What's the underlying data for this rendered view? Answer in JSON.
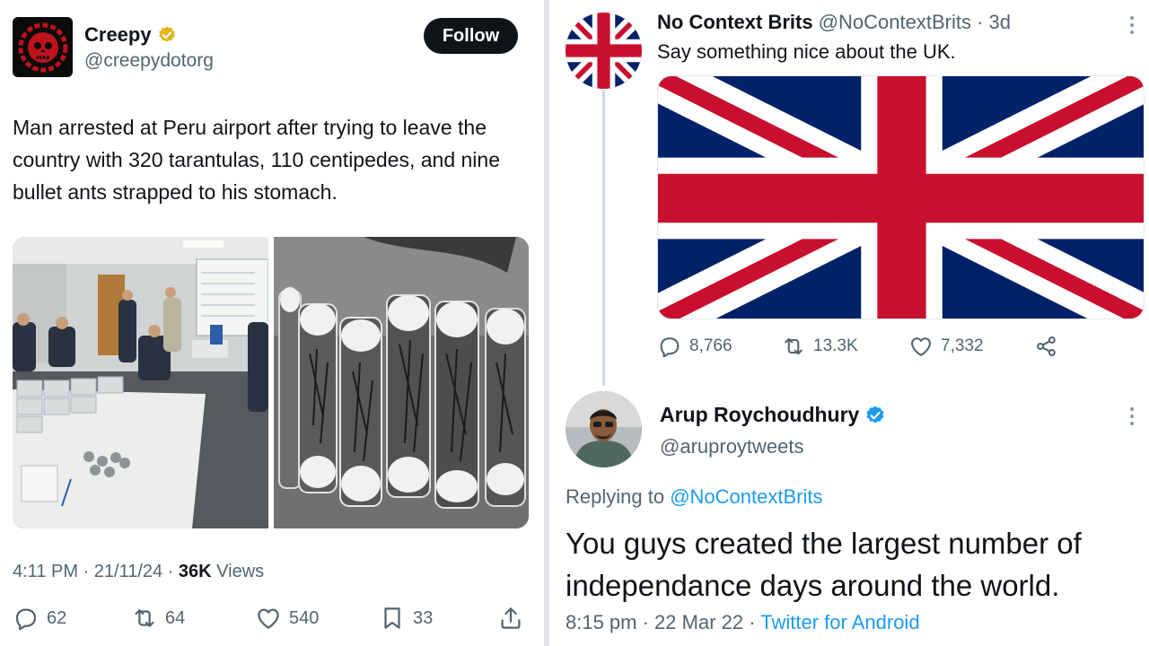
{
  "left_tweet": {
    "author_name": "Creepy",
    "author_handle": "@creepydotorg",
    "follow_label": "Follow",
    "text": "Man arrested at Peru airport after trying to leave the country with 320 tarantulas, 110 centipedes, and nine bullet ants strapped to his stomach.",
    "time": "4:11 PM · 21/11/24 · ",
    "views_count": "36K",
    "views_label": " Views",
    "actions": {
      "replies": "62",
      "retweets": "64",
      "likes": "540",
      "bookmarks": "33"
    },
    "icons": [
      "skull-logo-icon",
      "verified-gold-icon",
      "reply-icon",
      "retweet-icon",
      "like-icon",
      "bookmark-icon",
      "share-icon"
    ],
    "accent_color": "#c0121c"
  },
  "right_thread": {
    "tweet1": {
      "author_name": "No Context Brits",
      "author_handle": "@NoContextBrits",
      "age": " · 3d",
      "text": "Say something nice about the UK.",
      "actions": {
        "replies": "8,766",
        "retweets": "13.3K",
        "likes": "7,332"
      }
    },
    "tweet2": {
      "author_name": "Arup Roychoudhury",
      "author_handle": "@aruproytweets",
      "replying_prefix": "Replying to ",
      "replying_handle": "@NoContextBrits",
      "text": "You guys created the largest number of independance days around the world.",
      "time": "8:15 pm · 22 Mar 22 · ",
      "source": "Twitter for Android"
    },
    "link_color": "#1d9bf0",
    "flag_colors": {
      "blue": "#012169",
      "red": "#c8102e",
      "white": "#ffffff"
    }
  }
}
